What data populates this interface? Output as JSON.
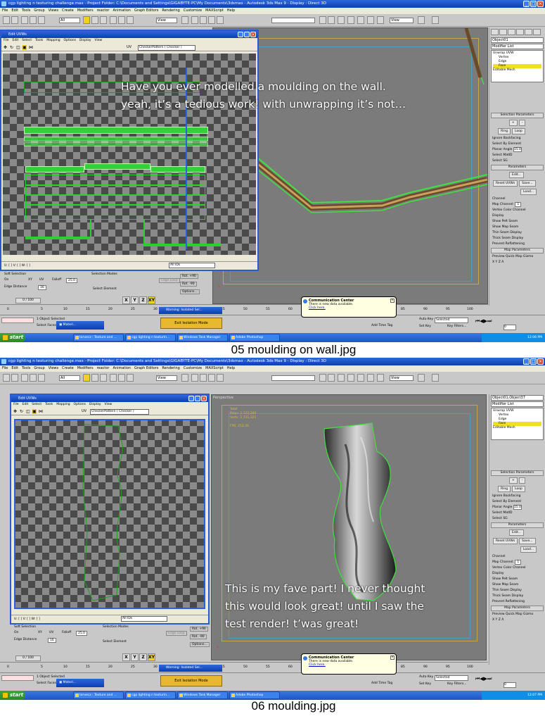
{
  "shot1": {
    "window_title": "cgp lighting n texturing challenge.max    - Project Folder: C:\\Documents and Settings\\GIGABYTE-PC\\My Documents\\3dsmax    - Autodesk 3ds Max 9      - Display : Direct 3D",
    "overlay_text": "Have you ever modelled a moulding on the wall.\nyeah, it’s a tedious work! with unwrapping it’s not…",
    "caption": "05 moulding on wall.jpg",
    "object_name": "Object01",
    "viewport_label": "",
    "stats": null
  },
  "shot2": {
    "window_title": "cgp lighting n texturing challenge.max    - Project Folder: C:\\Documents and Settings\\GIGABYTE-PC\\My Documents\\3dsmax    - Autodesk 3ds Max 9      - Display : Direct 3D",
    "overlay_text": "This is my fave part! I never thought\nthis would look great! until I saw the\ntest render! t’was great!",
    "caption": "06 moulding.jpg",
    "object_name": "Object01,Object37",
    "viewport_label": "Perspective",
    "stats": {
      "total": "Total",
      "polys": "Polys:   1,122,240",
      "verts": "Verts:   1,731,321",
      "fps": "FPS:     212.35"
    }
  },
  "menu": [
    "File",
    "Edit",
    "Tools",
    "Group",
    "Views",
    "Create",
    "Modifiers",
    "reactor",
    "Animation",
    "Graph Editors",
    "Rendering",
    "Customize",
    "MAXScript",
    "Help"
  ],
  "toolbar": {
    "selection_filter": "All",
    "ref_coord": "View",
    "named_sel": "View"
  },
  "uv_editor": {
    "title": "Edit UVWs",
    "menu": [
      "File",
      "Edit",
      "Select",
      "Tools",
      "Mapping",
      "Options",
      "Display",
      "View"
    ],
    "pattern": "CheckerPattern  ( Checker )",
    "uv_label": "UV",
    "ids": "All IDs"
  },
  "modifier_panel": {
    "modifier_list": "Modifier List",
    "stack": [
      "Unwrap UVW",
      "Vertex",
      "Edge",
      "Face",
      "Editable Mesh"
    ],
    "selected": "Face",
    "selection_params": "Selection Parameters",
    "ring": "Ring",
    "loop": "Loop",
    "checkboxes": [
      "Ignore Backfacing",
      "Select By Element",
      "Planar Angle"
    ],
    "planar_angle": "15.0",
    "select_matid": "Select MatID",
    "select_sg": "Select SG",
    "parameters": "Parameters",
    "edit": "Edit...",
    "reset_uvws": "Reset UVWs",
    "save": "Save...",
    "load": "Load...",
    "channel": "Channel",
    "map_channel": "Map Channel:",
    "map_channel_val": "1",
    "vertex_color": "Vertex Color Channel",
    "display": "Display",
    "show_pelt": "Show Pelt Seam",
    "show_map": "Show Map Seam",
    "thin_seam": "Thin Seam Display",
    "thick_seam": "Thick Seam Display",
    "prevent_reflat": "Prevent Reflattening",
    "map_params": "Map Parameters",
    "preview_gizmo": "Preview Quick Map Gizmo",
    "xyz": "X  Y  Z  A"
  },
  "low_panel": {
    "soft_selection": "Soft Selection",
    "on": "On",
    "xy": "XY",
    "uv": "UV",
    "falloff": "Falloff",
    "falloff_val": "25.0",
    "edge_distance": "Edge Distance",
    "edge_val": "16",
    "selection_modes": "Selection Modes",
    "edge_loop": "Edge Loop",
    "select_element": "Select Element",
    "rot_plus": "Rot. +90",
    "rot_minus": "Rot. -90",
    "options": "Options..."
  },
  "timeline": {
    "frame": "0 / 100",
    "ticks": [
      "0",
      "5",
      "10",
      "15",
      "20",
      "25",
      "30",
      "35",
      "40",
      "45",
      "50",
      "55",
      "60",
      "65",
      "70",
      "75",
      "80",
      "85",
      "90",
      "95",
      "100"
    ]
  },
  "status": {
    "selected": "1 Object Selected",
    "select_faces": "Select Faces",
    "warning": "Warning: Isolated Sel...",
    "exit_isolation": "Exit Isolation Mode",
    "add_time_tag": "Add Time Tag",
    "auto_key": "Auto Key",
    "set_key": "Set Key",
    "key_filters": "Key Filters...",
    "selected_drop": "Selected",
    "frame_field": "0"
  },
  "axis_buttons": [
    "X",
    "Y",
    "Z",
    "XY"
  ],
  "balloon": {
    "title": "Communication Center",
    "body": "There is new data available.",
    "link": "Click here."
  },
  "taskbar": {
    "start": "start",
    "tasks": [
      "torvecz : Texture and ...",
      "cgp lighting n texturin...",
      "Windows Task Manager",
      "Adobe Photoshop"
    ],
    "clock1": "12:06 PM",
    "clock2": "12:07 PM"
  },
  "colors": {
    "uv_green": "#34d03a",
    "title_blue": "#0b3fb4",
    "viewport_gray": "#7b7b7b",
    "face_highlight": "#f0e020"
  }
}
